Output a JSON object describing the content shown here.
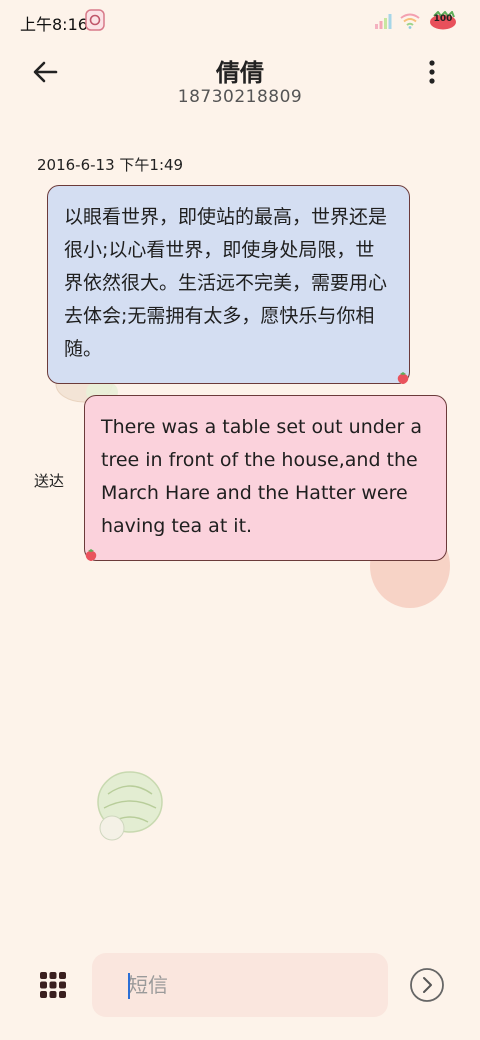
{
  "status_bar": {
    "time": "上午8:16",
    "battery_level": "100"
  },
  "header": {
    "contact_name": "倩倩",
    "contact_number": "18730218809"
  },
  "messages": [
    {
      "timestamp": "2016-6-13 下午1:49",
      "direction": "incoming",
      "text": "以眼看世界，即使站的最高，世界还是很小;以心看世界，即使身处局限，世界依然很大。生活远不完美，需要用心去体会;无需拥有太多，愿快乐与你相随。"
    },
    {
      "direction": "outgoing",
      "status": "送达",
      "text": "There was a table set out under a tree in front of the house,and the March Hare and the Hatter were having tea at it."
    }
  ],
  "compose": {
    "placeholder": "短信"
  },
  "colors": {
    "background": "#fdf3ea",
    "incoming_bubble": "#d4def2",
    "outgoing_bubble": "#fbd2dc",
    "bubble_border": "#6b3a3a",
    "compose_box": "#fae6de"
  },
  "icons": {
    "back": "arrow-left-icon",
    "more": "more-vertical-icon",
    "apps": "grid-apps-icon",
    "send": "send-circle-icon"
  }
}
